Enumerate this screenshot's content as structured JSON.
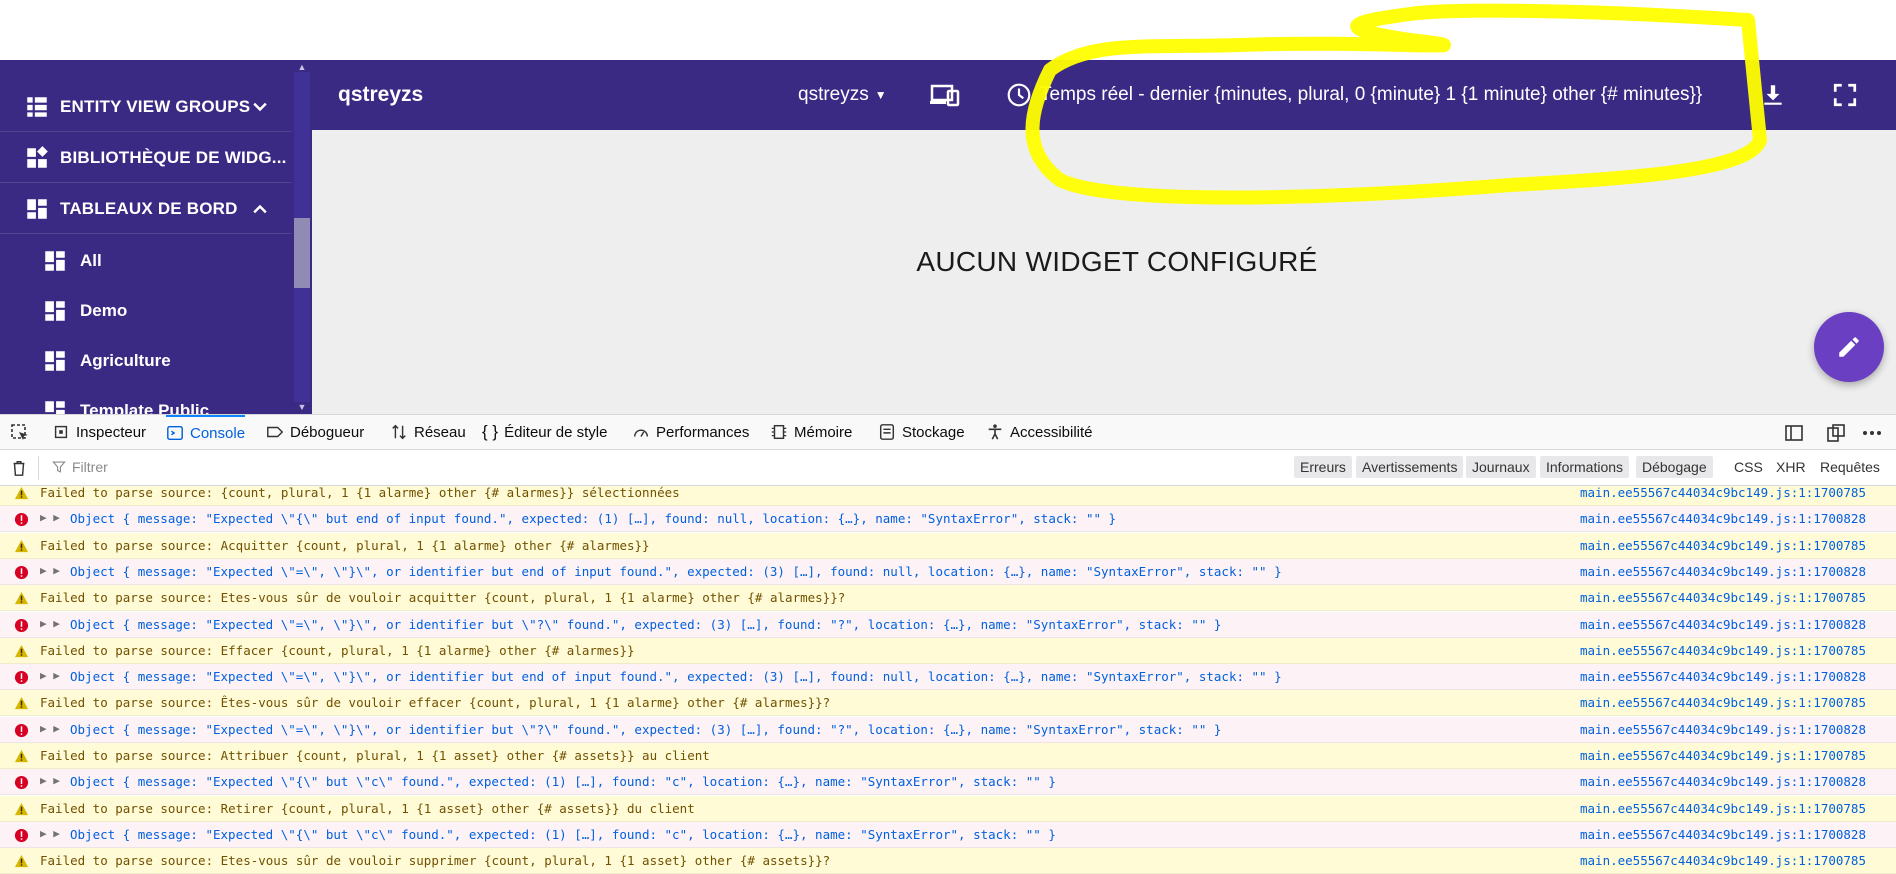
{
  "header": {
    "title": "qstreyzs",
    "selector_label": "qstreyzs",
    "time_window": "Temps réel - dernier {minutes, plural, 0 {minute} 1 {1 minute} other {# minutes}}"
  },
  "sidebar": {
    "items": [
      {
        "label": "ENTITY VIEW GROUPS"
      },
      {
        "label": "BIBLIOTHÈQUE DE WIDG..."
      },
      {
        "label": "TABLEAUX DE BORD"
      }
    ],
    "subitems": [
      {
        "label": "All"
      },
      {
        "label": "Demo"
      },
      {
        "label": "Agriculture"
      },
      {
        "label": "Template Public"
      }
    ]
  },
  "content": {
    "empty_message": "AUCUN WIDGET CONFIGURÉ"
  },
  "devtools": {
    "tabs": [
      "Inspecteur",
      "Console",
      "Débogueur",
      "Réseau",
      "Éditeur de style",
      "Performances",
      "Mémoire",
      "Stockage",
      "Accessibilité"
    ],
    "filter_placeholder": "Filtrer",
    "filters": [
      "Erreurs",
      "Avertissements",
      "Journaux",
      "Informations",
      "Débogage",
      "CSS",
      "XHR",
      "Requêtes"
    ]
  },
  "colors": {
    "primary": "#3b2a83",
    "fab": "#6a3fc2",
    "highlight": "#ffff00"
  },
  "console": {
    "rows": [
      {
        "type": "warn",
        "text": "Failed to parse source: {count, plural, 1 {1 alarme} other {# alarmes}} sélectionnées",
        "src": "main.ee55567c44034c9bc149.js:1:1700785"
      },
      {
        "type": "err",
        "text": "Object { message: \"Expected \\\"{\\\" but end of input found.\", expected: (1) […], found: null, location: {…}, name: \"SyntaxError\", stack: \"\" }",
        "src": "main.ee55567c44034c9bc149.js:1:1700828"
      },
      {
        "type": "warn",
        "text": "Failed to parse source: Acquitter {count, plural, 1 {1 alarme} other {# alarmes}}",
        "src": "main.ee55567c44034c9bc149.js:1:1700785"
      },
      {
        "type": "err",
        "text": "Object { message: \"Expected \\\"=\\\", \\\"}\\\", or identifier but end of input found.\", expected: (3) […], found: null, location: {…}, name: \"SyntaxError\", stack: \"\" }",
        "src": "main.ee55567c44034c9bc149.js:1:1700828"
      },
      {
        "type": "warn",
        "text": "Failed to parse source: Etes-vous sûr de vouloir acquitter {count, plural, 1 {1 alarme} other {# alarmes}}?",
        "src": "main.ee55567c44034c9bc149.js:1:1700785"
      },
      {
        "type": "err",
        "text": "Object { message: \"Expected \\\"=\\\", \\\"}\\\", or identifier but \\\"?\\\" found.\", expected: (3) […], found: \"?\", location: {…}, name: \"SyntaxError\", stack: \"\" }",
        "src": "main.ee55567c44034c9bc149.js:1:1700828"
      },
      {
        "type": "warn",
        "text": "Failed to parse source: Effacer {count, plural, 1 {1 alarme} other {# alarmes}}",
        "src": "main.ee55567c44034c9bc149.js:1:1700785"
      },
      {
        "type": "err",
        "text": "Object { message: \"Expected \\\"=\\\", \\\"}\\\", or identifier but end of input found.\", expected: (3) […], found: null, location: {…}, name: \"SyntaxError\", stack: \"\" }",
        "src": "main.ee55567c44034c9bc149.js:1:1700828"
      },
      {
        "type": "warn",
        "text": "Failed to parse source: Êtes-vous sûr de vouloir effacer {count, plural, 1 {1 alarme} other {# alarmes}}?",
        "src": "main.ee55567c44034c9bc149.js:1:1700785"
      },
      {
        "type": "err",
        "text": "Object { message: \"Expected \\\"=\\\", \\\"}\\\", or identifier but \\\"?\\\" found.\", expected: (3) […], found: \"?\", location: {…}, name: \"SyntaxError\", stack: \"\" }",
        "src": "main.ee55567c44034c9bc149.js:1:1700828"
      },
      {
        "type": "warn",
        "text": "Failed to parse source: Attribuer {count, plural, 1 {1 asset} other {# assets}} au client",
        "src": "main.ee55567c44034c9bc149.js:1:1700785"
      },
      {
        "type": "err",
        "text": "Object { message: \"Expected \\\"{\\\" but \\\"c\\\" found.\", expected: (1) […], found: \"c\", location: {…}, name: \"SyntaxError\", stack: \"\" }",
        "src": "main.ee55567c44034c9bc149.js:1:1700828"
      },
      {
        "type": "warn",
        "text": "Failed to parse source: Retirer {count, plural, 1 {1 asset} other {# assets}} du client",
        "src": "main.ee55567c44034c9bc149.js:1:1700785"
      },
      {
        "type": "err",
        "text": "Object { message: \"Expected \\\"{\\\" but \\\"c\\\" found.\", expected: (1) […], found: \"c\", location: {…}, name: \"SyntaxError\", stack: \"\" }",
        "src": "main.ee55567c44034c9bc149.js:1:1700828"
      },
      {
        "type": "warn",
        "text": "Failed to parse source: Etes-vous sûr de vouloir supprimer {count, plural, 1 {1 asset} other {# assets}}?",
        "src": "main.ee55567c44034c9bc149.js:1:1700785"
      }
    ]
  }
}
